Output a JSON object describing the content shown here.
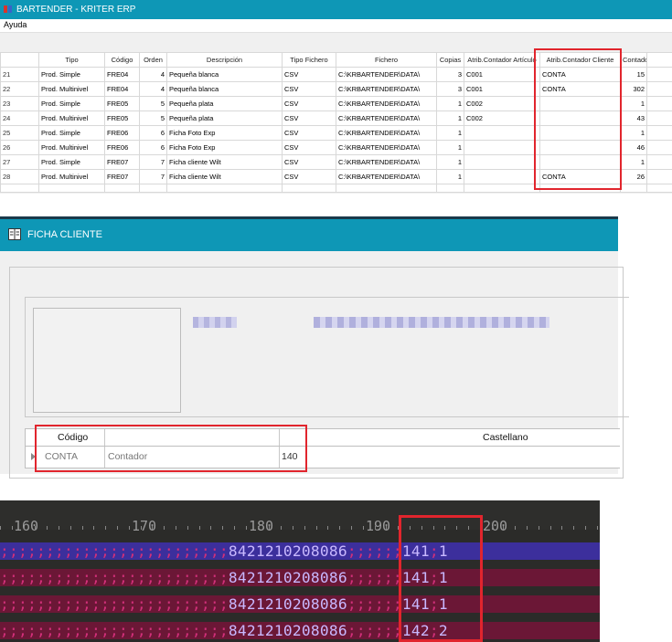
{
  "panel1": {
    "title": "BARTENDER - KRITER ERP",
    "menu": "Ayuda",
    "columns": [
      "",
      "Tipo",
      "Código",
      "Orden",
      "Descripción",
      "Tipo Fichero",
      "Fichero",
      "Copias",
      "Atrib.Contador Artículo",
      "Atrib.Contador Cliente",
      "Contador"
    ],
    "rows": [
      {
        "n": "21",
        "tipo": "Prod. Simple",
        "codigo": "FRE04",
        "orden": "4",
        "desc": "Pequeña blanca",
        "tipo_fichero": "CSV",
        "fichero": "C:\\KRBARTENDER\\DATA\\",
        "copias": "3",
        "art": "C001",
        "cli": "CONTA",
        "cont": "15"
      },
      {
        "n": "22",
        "tipo": "Prod. Multinivel",
        "codigo": "FRE04",
        "orden": "4",
        "desc": "Pequeña blanca",
        "tipo_fichero": "CSV",
        "fichero": "C:\\KRBARTENDER\\DATA\\",
        "copias": "3",
        "art": "C001",
        "cli": "CONTA",
        "cont": "302"
      },
      {
        "n": "23",
        "tipo": "Prod. Simple",
        "codigo": "FRE05",
        "orden": "5",
        "desc": "Pequeña plata",
        "tipo_fichero": "CSV",
        "fichero": "C:\\KRBARTENDER\\DATA\\",
        "copias": "1",
        "art": "C002",
        "cli": "",
        "cont": "1"
      },
      {
        "n": "24",
        "tipo": "Prod. Multinivel",
        "codigo": "FRE05",
        "orden": "5",
        "desc": "Pequeña plata",
        "tipo_fichero": "CSV",
        "fichero": "C:\\KRBARTENDER\\DATA\\",
        "copias": "1",
        "art": "C002",
        "cli": "",
        "cont": "43"
      },
      {
        "n": "25",
        "tipo": "Prod. Simple",
        "codigo": "FRE06",
        "orden": "6",
        "desc": "Ficha Foto Exp",
        "tipo_fichero": "CSV",
        "fichero": "C:\\KRBARTENDER\\DATA\\",
        "copias": "1",
        "art": "",
        "cli": "",
        "cont": "1"
      },
      {
        "n": "26",
        "tipo": "Prod. Multinivel",
        "codigo": "FRE06",
        "orden": "6",
        "desc": "Ficha Foto Exp",
        "tipo_fichero": "CSV",
        "fichero": "C:\\KRBARTENDER\\DATA\\",
        "copias": "1",
        "art": "",
        "cli": "",
        "cont": "46"
      },
      {
        "n": "27",
        "tipo": "Prod. Simple",
        "codigo": "FRE07",
        "orden": "7",
        "desc": "Ficha cliente Wilt",
        "tipo_fichero": "CSV",
        "fichero": "C:\\KRBARTENDER\\DATA\\",
        "copias": "1",
        "art": "",
        "cli": "",
        "cont": "1"
      },
      {
        "n": "28",
        "tipo": "Prod. Multinivel",
        "codigo": "FRE07",
        "orden": "7",
        "desc": "Ficha cliente Wilt",
        "tipo_fichero": "CSV",
        "fichero": "C:\\KRBARTENDER\\DATA\\",
        "copias": "1",
        "art": "",
        "cli": "CONTA",
        "cont": "26"
      }
    ]
  },
  "panel2": {
    "title": "FICHA CLIENTE",
    "headers": {
      "codigo": "Código",
      "castellano": "Castellano"
    },
    "row": {
      "codigo": "CONTA",
      "descripcion": "Contador",
      "valor": "140"
    }
  },
  "panel3": {
    "ruler": [
      "160",
      "170",
      "180",
      "190",
      "200"
    ],
    "lines": [
      {
        "dots_a": ";;;;;;;;;;;;;;;;;;;;;;;;;",
        "barcode": "8421210208086",
        "dots_b": ";;;;;;",
        "counter": "141",
        "sep": ";",
        "tail": "1",
        "bg": "#3c2f9c"
      },
      {
        "dots_a": ";;;;;;;;;;;;;;;;;;;;;;;;;",
        "barcode": "8421210208086",
        "dots_b": ";;;;;;",
        "counter": "141",
        "sep": ";",
        "tail": "1",
        "bg": "#6b1736"
      },
      {
        "dots_a": ";;;;;;;;;;;;;;;;;;;;;;;;;",
        "barcode": "8421210208086",
        "dots_b": ";;;;;;",
        "counter": "141",
        "sep": ";",
        "tail": "1",
        "bg": "#6b1736"
      },
      {
        "dots_a": ";;;;;;;;;;;;;;;;;;;;;;;;;",
        "barcode": "8421210208086",
        "dots_b": ";;;;;;",
        "counter": "142",
        "sep": ";",
        "tail": "2",
        "bg": "#6b1736"
      }
    ]
  },
  "colors": {
    "titlebar": "#0e97b6",
    "highlight": "#e1252d",
    "dots": "#d2307a",
    "value": "#c8b8ff"
  }
}
